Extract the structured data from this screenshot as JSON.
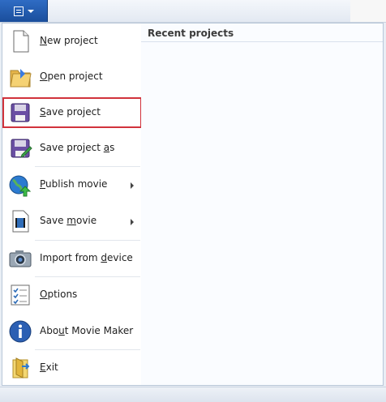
{
  "menu": {
    "items": [
      {
        "id": "new",
        "pre": "",
        "ul": "N",
        "post": "ew project",
        "submenu": false
      },
      {
        "id": "open",
        "pre": "",
        "ul": "O",
        "post": "pen project",
        "submenu": false
      },
      {
        "id": "save",
        "pre": "",
        "ul": "S",
        "post": "ave project",
        "submenu": false
      },
      {
        "id": "saveas",
        "pre": "Save project ",
        "ul": "a",
        "post": "s",
        "submenu": false
      },
      {
        "id": "publish",
        "pre": "",
        "ul": "P",
        "post": "ublish movie",
        "submenu": true
      },
      {
        "id": "savemovie",
        "pre": "Save ",
        "ul": "m",
        "post": "ovie",
        "submenu": true
      },
      {
        "id": "import",
        "pre": "Import from ",
        "ul": "d",
        "post": "evice",
        "submenu": false
      },
      {
        "id": "options",
        "pre": "",
        "ul": "O",
        "post": "ptions",
        "submenu": false
      },
      {
        "id": "about",
        "pre": "Abo",
        "ul": "u",
        "post": "t Movie Maker",
        "submenu": false
      },
      {
        "id": "exit",
        "pre": "",
        "ul": "E",
        "post": "xit",
        "submenu": false
      }
    ]
  },
  "recent": {
    "title": "Recent projects"
  },
  "icons": {
    "app_menu": "document-icon",
    "new": "new-document-icon",
    "open": "folder-icon",
    "save": "floppy-disk-icon",
    "saveas": "floppy-disk-edit-icon",
    "publish": "globe-upload-icon",
    "savemovie": "film-document-icon",
    "import": "camera-icon",
    "options": "checklist-icon",
    "about": "info-icon",
    "exit": "exit-document-icon"
  },
  "colors": {
    "accent": "#1f56a8",
    "highlight": "#d1333c"
  }
}
